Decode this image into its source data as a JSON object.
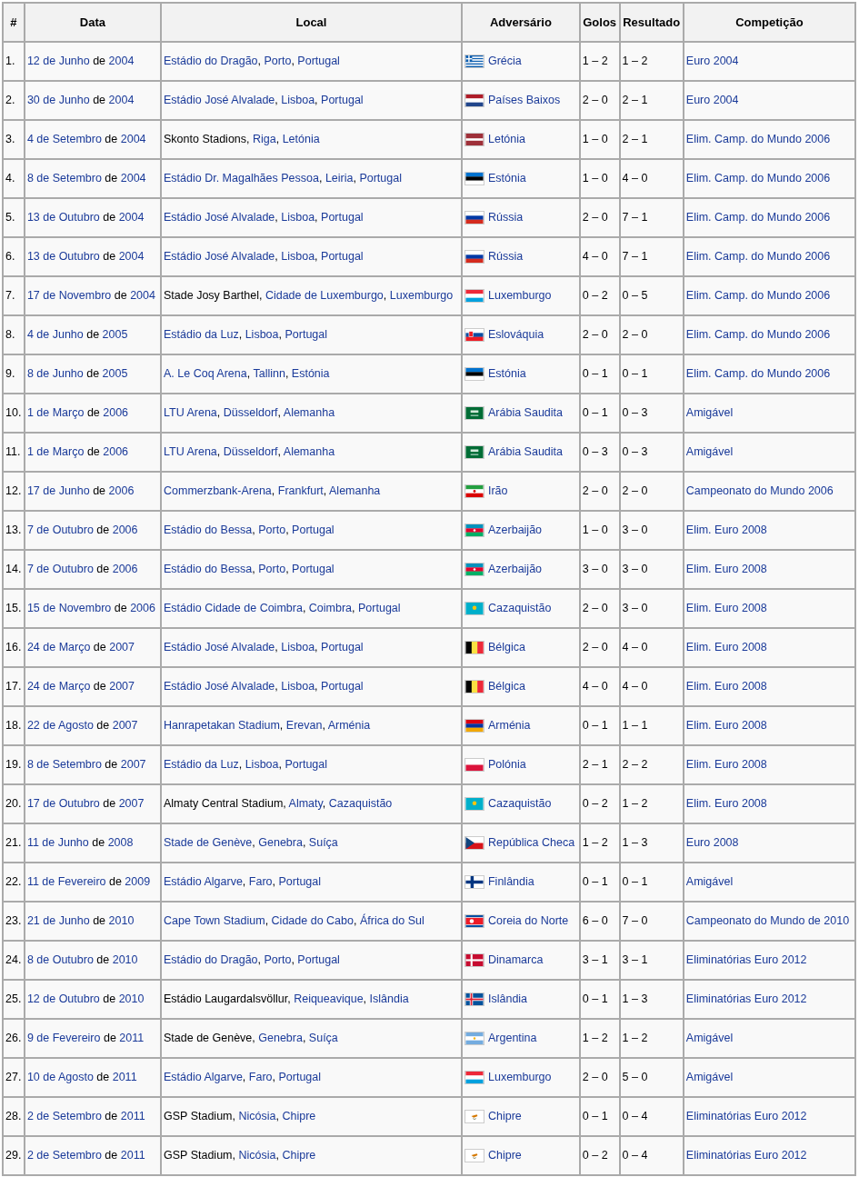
{
  "columns": [
    "#",
    "Data",
    "Local",
    "Adversário",
    "Golos",
    "Resultado",
    "Competição"
  ],
  "rows": [
    {
      "number": "1.",
      "date": [
        {
          "text": "12 de Junho",
          "link": true
        },
        {
          "text": " de ",
          "link": false
        },
        {
          "text": "2004",
          "link": true
        }
      ],
      "venue": [
        {
          "text": "Estádio do Dragão",
          "link": true
        },
        {
          "text": ", ",
          "link": false
        },
        {
          "text": "Porto",
          "link": true
        },
        {
          "text": ", ",
          "link": false
        },
        {
          "text": "Portugal",
          "link": true
        }
      ],
      "flag": {
        "kind": "greece"
      },
      "opponent": "Grécia",
      "goals": "1 – 2",
      "result": "1 – 2",
      "competition": "Euro 2004"
    },
    {
      "number": "2.",
      "date": [
        {
          "text": "30 de Junho",
          "link": true
        },
        {
          "text": " de ",
          "link": false
        },
        {
          "text": "2004",
          "link": true
        }
      ],
      "venue": [
        {
          "text": "Estádio José Alvalade",
          "link": true
        },
        {
          "text": ", ",
          "link": false
        },
        {
          "text": "Lisboa",
          "link": true
        },
        {
          "text": ", ",
          "link": false
        },
        {
          "text": "Portugal",
          "link": true
        }
      ],
      "flag": {
        "kind": "netherlands"
      },
      "opponent": "Países Baixos",
      "goals": "2 – 0",
      "result": "2 – 1",
      "competition": "Euro 2004"
    },
    {
      "number": "3.",
      "date": [
        {
          "text": "4 de Setembro",
          "link": true
        },
        {
          "text": " de ",
          "link": false
        },
        {
          "text": "2004",
          "link": true
        }
      ],
      "venue": [
        {
          "text": "Skonto Stadions",
          "link": false
        },
        {
          "text": ", ",
          "link": false
        },
        {
          "text": "Riga",
          "link": true
        },
        {
          "text": ", ",
          "link": false
        },
        {
          "text": "Letónia",
          "link": true
        }
      ],
      "flag": {
        "kind": "latvia"
      },
      "opponent": "Letónia",
      "goals": "1 – 0",
      "result": "2 – 1",
      "competition": "Elim. Camp. do Mundo 2006"
    },
    {
      "number": "4.",
      "date": [
        {
          "text": "8 de Setembro",
          "link": true
        },
        {
          "text": " de ",
          "link": false
        },
        {
          "text": "2004",
          "link": true
        }
      ],
      "venue": [
        {
          "text": "Estádio Dr. Magalhães Pessoa",
          "link": true
        },
        {
          "text": ", ",
          "link": false
        },
        {
          "text": "Leiria",
          "link": true
        },
        {
          "text": ", ",
          "link": false
        },
        {
          "text": "Portugal",
          "link": true
        }
      ],
      "flag": {
        "kind": "estonia"
      },
      "opponent": "Estónia",
      "goals": "1 – 0",
      "result": "4 – 0",
      "competition": "Elim. Camp. do Mundo 2006"
    },
    {
      "number": "5.",
      "date": [
        {
          "text": "13 de Outubro",
          "link": true
        },
        {
          "text": " de ",
          "link": false
        },
        {
          "text": "2004",
          "link": true
        }
      ],
      "venue": [
        {
          "text": "Estádio José Alvalade",
          "link": true
        },
        {
          "text": ", ",
          "link": false
        },
        {
          "text": "Lisboa",
          "link": true
        },
        {
          "text": ", ",
          "link": false
        },
        {
          "text": "Portugal",
          "link": true
        }
      ],
      "flag": {
        "kind": "russia"
      },
      "opponent": "Rússia",
      "goals": "2 – 0",
      "result": "7 – 1",
      "competition": "Elim. Camp. do Mundo 2006"
    },
    {
      "number": "6.",
      "date": [
        {
          "text": "13 de Outubro",
          "link": true
        },
        {
          "text": " de ",
          "link": false
        },
        {
          "text": "2004",
          "link": true
        }
      ],
      "venue": [
        {
          "text": "Estádio José Alvalade",
          "link": true
        },
        {
          "text": ", ",
          "link": false
        },
        {
          "text": "Lisboa",
          "link": true
        },
        {
          "text": ", ",
          "link": false
        },
        {
          "text": "Portugal",
          "link": true
        }
      ],
      "flag": {
        "kind": "russia"
      },
      "opponent": "Rússia",
      "goals": "4 – 0",
      "result": "7 – 1",
      "competition": "Elim. Camp. do Mundo 2006"
    },
    {
      "number": "7.",
      "date": [
        {
          "text": "17 de Novembro",
          "link": true
        },
        {
          "text": " de ",
          "link": false
        },
        {
          "text": "2004",
          "link": true
        }
      ],
      "venue": [
        {
          "text": "Stade Josy Barthel",
          "link": false
        },
        {
          "text": ", ",
          "link": false
        },
        {
          "text": "Cidade de Luxemburgo",
          "link": true
        },
        {
          "text": ", ",
          "link": false
        },
        {
          "text": "Luxemburgo",
          "link": true
        }
      ],
      "flag": {
        "kind": "luxembourg"
      },
      "opponent": "Luxemburgo",
      "goals": "0 – 2",
      "result": "0 – 5",
      "competition": "Elim. Camp. do Mundo 2006"
    },
    {
      "number": "8.",
      "date": [
        {
          "text": "4 de Junho",
          "link": true
        },
        {
          "text": " de ",
          "link": false
        },
        {
          "text": "2005",
          "link": true
        }
      ],
      "venue": [
        {
          "text": "Estádio da Luz",
          "link": true
        },
        {
          "text": ", ",
          "link": false
        },
        {
          "text": "Lisboa",
          "link": true
        },
        {
          "text": ", ",
          "link": false
        },
        {
          "text": "Portugal",
          "link": true
        }
      ],
      "flag": {
        "kind": "slovakia"
      },
      "opponent": "Eslováquia",
      "goals": "2 – 0",
      "result": "2 – 0",
      "competition": "Elim. Camp. do Mundo 2006"
    },
    {
      "number": "9.",
      "date": [
        {
          "text": "8 de Junho",
          "link": true
        },
        {
          "text": " de ",
          "link": false
        },
        {
          "text": "2005",
          "link": true
        }
      ],
      "venue": [
        {
          "text": "A. Le Coq Arena",
          "link": true
        },
        {
          "text": ", ",
          "link": false
        },
        {
          "text": "Tallinn",
          "link": true
        },
        {
          "text": ", ",
          "link": false
        },
        {
          "text": "Estónia",
          "link": true
        }
      ],
      "flag": {
        "kind": "estonia"
      },
      "opponent": "Estónia",
      "goals": "0 – 1",
      "result": "0 – 1",
      "competition": "Elim. Camp. do Mundo 2006"
    },
    {
      "number": "10.",
      "date": [
        {
          "text": "1 de Março",
          "link": true
        },
        {
          "text": " de ",
          "link": false
        },
        {
          "text": "2006",
          "link": true
        }
      ],
      "venue": [
        {
          "text": "LTU Arena",
          "link": true
        },
        {
          "text": ", ",
          "link": false
        },
        {
          "text": "Düsseldorf",
          "link": true
        },
        {
          "text": ", ",
          "link": false
        },
        {
          "text": "Alemanha",
          "link": true
        }
      ],
      "flag": {
        "kind": "saudi"
      },
      "opponent": "Arábia Saudita",
      "goals": "0 – 1",
      "result": "0 – 3",
      "competition": "Amigável"
    },
    {
      "number": "11.",
      "date": [
        {
          "text": "1 de Março",
          "link": true
        },
        {
          "text": " de ",
          "link": false
        },
        {
          "text": "2006",
          "link": true
        }
      ],
      "venue": [
        {
          "text": "LTU Arena",
          "link": true
        },
        {
          "text": ", ",
          "link": false
        },
        {
          "text": "Düsseldorf",
          "link": true
        },
        {
          "text": ", ",
          "link": false
        },
        {
          "text": "Alemanha",
          "link": true
        }
      ],
      "flag": {
        "kind": "saudi"
      },
      "opponent": "Arábia Saudita",
      "goals": "0 – 3",
      "result": "0 – 3",
      "competition": "Amigável"
    },
    {
      "number": "12.",
      "date": [
        {
          "text": "17 de Junho",
          "link": true
        },
        {
          "text": " de ",
          "link": false
        },
        {
          "text": "2006",
          "link": true
        }
      ],
      "venue": [
        {
          "text": "Commerzbank-Arena",
          "link": true
        },
        {
          "text": ", ",
          "link": false
        },
        {
          "text": "Frankfurt",
          "link": true
        },
        {
          "text": ", ",
          "link": false
        },
        {
          "text": "Alemanha",
          "link": true
        }
      ],
      "flag": {
        "kind": "iran"
      },
      "opponent": "Irão",
      "goals": "2 – 0",
      "result": "2 – 0",
      "competition": "Campeonato do Mundo 2006"
    },
    {
      "number": "13.",
      "date": [
        {
          "text": "7 de Outubro",
          "link": true
        },
        {
          "text": " de ",
          "link": false
        },
        {
          "text": "2006",
          "link": true
        }
      ],
      "venue": [
        {
          "text": "Estádio do Bessa",
          "link": true
        },
        {
          "text": ", ",
          "link": false
        },
        {
          "text": "Porto",
          "link": true
        },
        {
          "text": ", ",
          "link": false
        },
        {
          "text": "Portugal",
          "link": true
        }
      ],
      "flag": {
        "kind": "azerbaijan"
      },
      "opponent": "Azerbaijão",
      "goals": "1 – 0",
      "result": "3 – 0",
      "competition": "Elim. Euro 2008"
    },
    {
      "number": "14.",
      "date": [
        {
          "text": "7 de Outubro",
          "link": true
        },
        {
          "text": " de ",
          "link": false
        },
        {
          "text": "2006",
          "link": true
        }
      ],
      "venue": [
        {
          "text": "Estádio do Bessa",
          "link": true
        },
        {
          "text": ", ",
          "link": false
        },
        {
          "text": "Porto",
          "link": true
        },
        {
          "text": ", ",
          "link": false
        },
        {
          "text": "Portugal",
          "link": true
        }
      ],
      "flag": {
        "kind": "azerbaijan"
      },
      "opponent": "Azerbaijão",
      "goals": "3 – 0",
      "result": "3 – 0",
      "competition": "Elim. Euro 2008"
    },
    {
      "number": "15.",
      "date": [
        {
          "text": "15 de Novembro",
          "link": true
        },
        {
          "text": " de ",
          "link": false
        },
        {
          "text": "2006",
          "link": true
        }
      ],
      "venue": [
        {
          "text": "Estádio Cidade de Coimbra",
          "link": true
        },
        {
          "text": ", ",
          "link": false
        },
        {
          "text": "Coimbra",
          "link": true
        },
        {
          "text": ", ",
          "link": false
        },
        {
          "text": "Portugal",
          "link": true
        }
      ],
      "flag": {
        "kind": "kazakhstan"
      },
      "opponent": "Cazaquistão",
      "goals": "2 – 0",
      "result": "3 – 0",
      "competition": "Elim. Euro 2008"
    },
    {
      "number": "16.",
      "date": [
        {
          "text": "24 de Março",
          "link": true
        },
        {
          "text": " de ",
          "link": false
        },
        {
          "text": "2007",
          "link": true
        }
      ],
      "venue": [
        {
          "text": "Estádio José Alvalade",
          "link": true
        },
        {
          "text": ", ",
          "link": false
        },
        {
          "text": "Lisboa",
          "link": true
        },
        {
          "text": ", ",
          "link": false
        },
        {
          "text": "Portugal",
          "link": true
        }
      ],
      "flag": {
        "kind": "belgium"
      },
      "opponent": "Bélgica",
      "goals": "2 – 0",
      "result": "4 – 0",
      "competition": "Elim. Euro 2008"
    },
    {
      "number": "17.",
      "date": [
        {
          "text": "24 de Março",
          "link": true
        },
        {
          "text": " de ",
          "link": false
        },
        {
          "text": "2007",
          "link": true
        }
      ],
      "venue": [
        {
          "text": "Estádio José Alvalade",
          "link": true
        },
        {
          "text": ", ",
          "link": false
        },
        {
          "text": "Lisboa",
          "link": true
        },
        {
          "text": ", ",
          "link": false
        },
        {
          "text": "Portugal",
          "link": true
        }
      ],
      "flag": {
        "kind": "belgium"
      },
      "opponent": "Bélgica",
      "goals": "4 – 0",
      "result": "4 – 0",
      "competition": "Elim. Euro 2008"
    },
    {
      "number": "18.",
      "date": [
        {
          "text": "22 de Agosto",
          "link": true
        },
        {
          "text": " de ",
          "link": false
        },
        {
          "text": "2007",
          "link": true
        }
      ],
      "venue": [
        {
          "text": "Hanrapetakan Stadium",
          "link": true
        },
        {
          "text": ", ",
          "link": false
        },
        {
          "text": "Erevan",
          "link": true
        },
        {
          "text": ", ",
          "link": false
        },
        {
          "text": "Arménia",
          "link": true
        }
      ],
      "flag": {
        "kind": "armenia"
      },
      "opponent": "Arménia",
      "goals": "0 – 1",
      "result": "1 – 1",
      "competition": "Elim. Euro 2008"
    },
    {
      "number": "19.",
      "date": [
        {
          "text": "8 de Setembro",
          "link": true
        },
        {
          "text": " de ",
          "link": false
        },
        {
          "text": "2007",
          "link": true
        }
      ],
      "venue": [
        {
          "text": "Estádio da Luz",
          "link": true
        },
        {
          "text": ", ",
          "link": false
        },
        {
          "text": "Lisboa",
          "link": true
        },
        {
          "text": ", ",
          "link": false
        },
        {
          "text": "Portugal",
          "link": true
        }
      ],
      "flag": {
        "kind": "poland"
      },
      "opponent": "Polónia",
      "goals": "2 – 1",
      "result": "2 – 2",
      "competition": "Elim. Euro 2008"
    },
    {
      "number": "20.",
      "date": [
        {
          "text": "17 de Outubro",
          "link": true
        },
        {
          "text": " de ",
          "link": false
        },
        {
          "text": "2007",
          "link": true
        }
      ],
      "venue": [
        {
          "text": "Almaty Central Stadium",
          "link": false
        },
        {
          "text": ", ",
          "link": false
        },
        {
          "text": "Almaty",
          "link": true
        },
        {
          "text": ", ",
          "link": false
        },
        {
          "text": "Cazaquistão",
          "link": true
        }
      ],
      "flag": {
        "kind": "kazakhstan"
      },
      "opponent": "Cazaquistão",
      "goals": "0 – 2",
      "result": "1 – 2",
      "competition": "Elim. Euro 2008"
    },
    {
      "number": "21.",
      "date": [
        {
          "text": "11 de Junho",
          "link": true
        },
        {
          "text": " de ",
          "link": false
        },
        {
          "text": "2008",
          "link": true
        }
      ],
      "venue": [
        {
          "text": "Stade de Genève",
          "link": true
        },
        {
          "text": ", ",
          "link": false
        },
        {
          "text": "Genebra",
          "link": true
        },
        {
          "text": ", ",
          "link": false
        },
        {
          "text": "Suíça",
          "link": true
        }
      ],
      "flag": {
        "kind": "czech"
      },
      "opponent": "República Checa",
      "goals": "1 – 2",
      "result": "1 – 3",
      "competition": "Euro 2008"
    },
    {
      "number": "22.",
      "date": [
        {
          "text": "11 de Fevereiro",
          "link": true
        },
        {
          "text": " de ",
          "link": false
        },
        {
          "text": "2009",
          "link": true
        }
      ],
      "venue": [
        {
          "text": "Estádio Algarve",
          "link": true
        },
        {
          "text": ", ",
          "link": false
        },
        {
          "text": "Faro",
          "link": true
        },
        {
          "text": ", ",
          "link": false
        },
        {
          "text": "Portugal",
          "link": true
        }
      ],
      "flag": {
        "kind": "finland"
      },
      "opponent": "Finlândia",
      "goals": "0 – 1",
      "result": "0 – 1",
      "competition": "Amigável"
    },
    {
      "number": "23.",
      "date": [
        {
          "text": "21 de Junho",
          "link": true
        },
        {
          "text": " de ",
          "link": false
        },
        {
          "text": "2010",
          "link": true
        }
      ],
      "venue": [
        {
          "text": "Cape Town Stadium",
          "link": true
        },
        {
          "text": ", ",
          "link": false
        },
        {
          "text": "Cidade do Cabo",
          "link": true
        },
        {
          "text": ", ",
          "link": false
        },
        {
          "text": "África do Sul",
          "link": true
        }
      ],
      "flag": {
        "kind": "northkorea"
      },
      "opponent": "Coreia do Norte",
      "goals": "6 – 0",
      "result": "7 – 0",
      "competition": "Campeonato do Mundo de 2010"
    },
    {
      "number": "24.",
      "date": [
        {
          "text": "8 de Outubro",
          "link": true
        },
        {
          "text": " de ",
          "link": false
        },
        {
          "text": "2010",
          "link": true
        }
      ],
      "venue": [
        {
          "text": "Estádio do Dragão",
          "link": true
        },
        {
          "text": ", ",
          "link": false
        },
        {
          "text": "Porto",
          "link": true
        },
        {
          "text": ", ",
          "link": false
        },
        {
          "text": "Portugal",
          "link": true
        }
      ],
      "flag": {
        "kind": "denmark"
      },
      "opponent": "Dinamarca",
      "goals": "3 – 1",
      "result": "3 – 1",
      "competition": "Eliminatórias Euro 2012"
    },
    {
      "number": "25.",
      "date": [
        {
          "text": "12 de Outubro",
          "link": true
        },
        {
          "text": " de ",
          "link": false
        },
        {
          "text": "2010",
          "link": true
        }
      ],
      "venue": [
        {
          "text": "Estádio Laugardalsvöllur",
          "link": false
        },
        {
          "text": ", ",
          "link": false
        },
        {
          "text": "Reiqueavique",
          "link": true
        },
        {
          "text": ", ",
          "link": false
        },
        {
          "text": "Islândia",
          "link": true
        }
      ],
      "flag": {
        "kind": "iceland"
      },
      "opponent": "Islândia",
      "goals": "0 – 1",
      "result": "1 – 3",
      "competition": "Eliminatórias Euro 2012"
    },
    {
      "number": "26.",
      "date": [
        {
          "text": "9 de Fevereiro",
          "link": true
        },
        {
          "text": " de ",
          "link": false
        },
        {
          "text": "2011",
          "link": true
        }
      ],
      "venue": [
        {
          "text": "Stade de Genève",
          "link": false
        },
        {
          "text": ", ",
          "link": false
        },
        {
          "text": "Genebra",
          "link": true
        },
        {
          "text": ", ",
          "link": false
        },
        {
          "text": "Suíça",
          "link": true
        }
      ],
      "flag": {
        "kind": "argentina"
      },
      "opponent": "Argentina",
      "goals": "1 – 2",
      "result": "1 – 2",
      "competition": "Amigável"
    },
    {
      "number": "27.",
      "date": [
        {
          "text": "10 de Agosto",
          "link": true
        },
        {
          "text": " de ",
          "link": false
        },
        {
          "text": "2011",
          "link": true
        }
      ],
      "venue": [
        {
          "text": "Estádio Algarve",
          "link": true
        },
        {
          "text": ", ",
          "link": false
        },
        {
          "text": "Faro",
          "link": true
        },
        {
          "text": ", ",
          "link": false
        },
        {
          "text": "Portugal",
          "link": true
        }
      ],
      "flag": {
        "kind": "luxembourg"
      },
      "opponent": "Luxemburgo",
      "goals": "2 – 0",
      "result": "5 – 0",
      "competition": "Amigável"
    },
    {
      "number": "28.",
      "date": [
        {
          "text": "2 de Setembro",
          "link": true
        },
        {
          "text": " de ",
          "link": false
        },
        {
          "text": "2011",
          "link": true
        }
      ],
      "venue": [
        {
          "text": "GSP Stadium",
          "link": false
        },
        {
          "text": ", ",
          "link": false
        },
        {
          "text": "Nicósia",
          "link": true
        },
        {
          "text": ", ",
          "link": false
        },
        {
          "text": "Chipre",
          "link": true
        }
      ],
      "flag": {
        "kind": "cyprus"
      },
      "opponent": "Chipre",
      "goals": "0 – 1",
      "result": "0 – 4",
      "competition": "Eliminatórias Euro 2012"
    },
    {
      "number": "29.",
      "date": [
        {
          "text": "2 de Setembro",
          "link": true
        },
        {
          "text": " de ",
          "link": false
        },
        {
          "text": "2011",
          "link": true
        }
      ],
      "venue": [
        {
          "text": "GSP Stadium",
          "link": false
        },
        {
          "text": ", ",
          "link": false
        },
        {
          "text": "Nicósia",
          "link": true
        },
        {
          "text": ", ",
          "link": false
        },
        {
          "text": "Chipre",
          "link": true
        }
      ],
      "flag": {
        "kind": "cyprus"
      },
      "opponent": "Chipre",
      "goals": "0 – 2",
      "result": "0 – 4",
      "competition": "Eliminatórias Euro 2012"
    }
  ]
}
